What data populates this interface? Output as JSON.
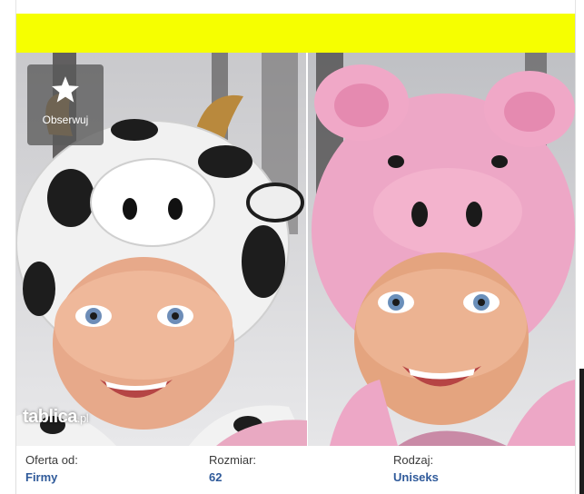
{
  "listing": {
    "watch_button": {
      "label": "Obserwuj",
      "icon": "star-icon"
    },
    "watermark": {
      "brand": "tabl",
      "brand2": "ca",
      "suffix": ".pl"
    },
    "banner_color": "#f6ff00",
    "params": [
      {
        "label": "Oferta od:",
        "value": "Firmy"
      },
      {
        "label": "Rozmiar:",
        "value": "62"
      },
      {
        "label": "Rodzaj:",
        "value": "Uniseks"
      }
    ]
  }
}
